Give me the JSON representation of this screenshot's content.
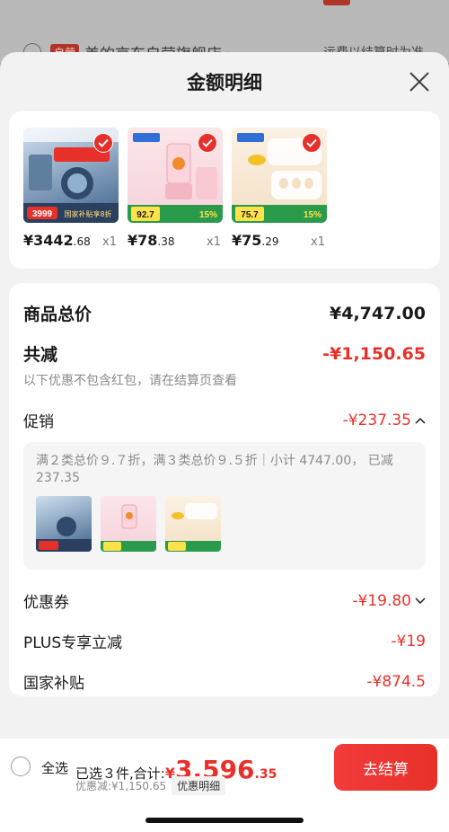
{
  "background": {
    "shop_tag": "自营",
    "shop_name": "美的京东自营旗舰店 ›",
    "shipping_note": "运费以结算时为准"
  },
  "sheet": {
    "title": "金额明细"
  },
  "products": [
    {
      "price_main": "¥3442",
      "price_cents": ".68",
      "qty": "x1",
      "thumb_badge": "3999",
      "thumb_label": "国家补贴享8折"
    },
    {
      "price_main": "¥78",
      "price_cents": ".38",
      "qty": "x1",
      "thumb_badge": "92.7",
      "thumb_label": "15%"
    },
    {
      "price_main": "¥75",
      "price_cents": ".29",
      "qty": "x1",
      "thumb_badge": "75.7",
      "thumb_label": "15%"
    }
  ],
  "summary": {
    "total_label": "商品总价",
    "total_value": "¥4,747.00",
    "reduce_label": "共减",
    "reduce_value": "-¥1,150.65",
    "reduce_note": "以下优惠不包含红包，请在结算页查看",
    "promo_label": "促销",
    "promo_value": "-¥237.35",
    "promo_detail": "满２类总价９.７折，满３类总价９.５折｜小计 4747.00， 已减 237.35",
    "coupon_label": "优惠券",
    "coupon_value": "-¥19.80",
    "plus_label": "PLUS专享立减",
    "plus_value": "-¥19",
    "subsidy_label": "国家补贴",
    "subsidy_value": "-¥874.5"
  },
  "bottom": {
    "select_all": "全选",
    "selected": "已选３件,合计:",
    "total_sign": "¥",
    "total_main": "3,596",
    "total_cents": ".35",
    "discount": "优惠减:¥1,150.65",
    "detail_chip": "优惠明细",
    "checkout": "去结算"
  },
  "colors": {
    "accent_red": "#e8302a",
    "sheet_bg": "#f2f2f2"
  }
}
